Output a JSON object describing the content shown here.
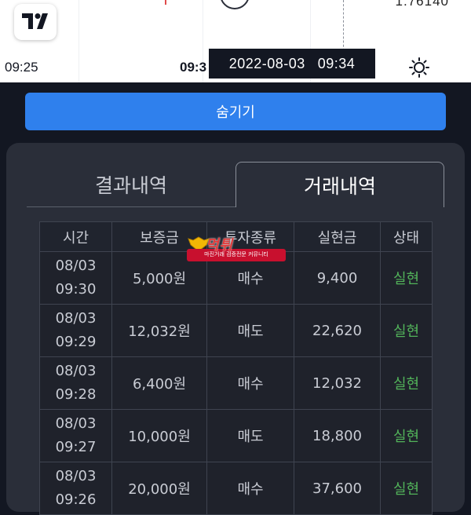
{
  "chart": {
    "price": "1.76140",
    "time_labels": [
      "09:25",
      "09:3"
    ],
    "crosshair_date": "2022-08-03",
    "crosshair_time": "09:34",
    "logo": "tradingview-logo",
    "theme_icon": "sun-icon"
  },
  "hide_button_label": "숨기기",
  "tabs": [
    {
      "label": "결과내역",
      "active": false
    },
    {
      "label": "거래내역",
      "active": true
    }
  ],
  "table": {
    "headers": [
      "시간",
      "보증금",
      "투자종류",
      "실현금",
      "상태"
    ],
    "rows": [
      {
        "date": "08/03",
        "time": "09:30",
        "deposit": "5,000원",
        "type": "매수",
        "realized": "9,400",
        "status": "실현"
      },
      {
        "date": "08/03",
        "time": "09:29",
        "deposit": "12,032원",
        "type": "매도",
        "realized": "22,620",
        "status": "실현"
      },
      {
        "date": "08/03",
        "time": "09:28",
        "deposit": "6,400원",
        "type": "매수",
        "realized": "12,032",
        "status": "실현"
      },
      {
        "date": "08/03",
        "time": "09:27",
        "deposit": "10,000원",
        "type": "매도",
        "realized": "18,800",
        "status": "실현"
      },
      {
        "date": "08/03",
        "time": "09:26",
        "deposit": "20,000원",
        "type": "매수",
        "realized": "37,600",
        "status": "실현"
      }
    ]
  },
  "watermark": {
    "title": "먹튀",
    "subtitle": "마진거래 검증전문 커뮤니티"
  },
  "colors": {
    "accent": "#2f80ed",
    "status_realized": "#52b35a",
    "background": "#131722",
    "panel": "#2a2e39"
  }
}
